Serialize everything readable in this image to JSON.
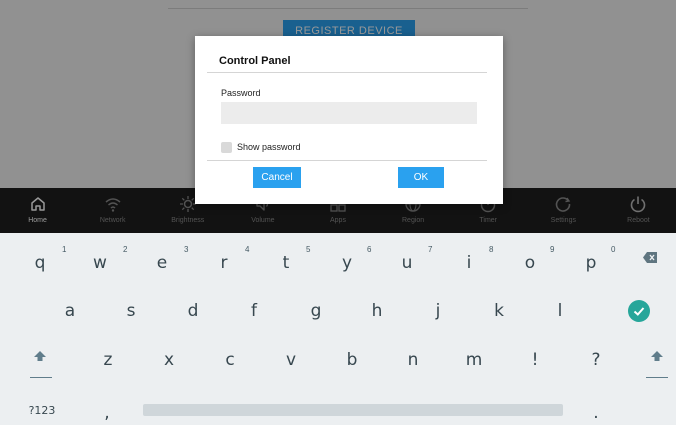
{
  "background": {
    "register_label": "REGISTER DEVICE"
  },
  "navbar": {
    "items": [
      {
        "label": "Home",
        "icon": "home-icon"
      },
      {
        "label": "Network",
        "icon": "wifi-icon"
      },
      {
        "label": "Brightness",
        "icon": "brightness-icon"
      },
      {
        "label": "Volume",
        "icon": "volume-icon"
      },
      {
        "label": "Apps",
        "icon": "apps-icon"
      },
      {
        "label": "Region",
        "icon": "globe-icon"
      },
      {
        "label": "Timer",
        "icon": "timer-icon"
      },
      {
        "label": "Settings",
        "icon": "settings-icon"
      },
      {
        "label": "Reboot",
        "icon": "power-icon"
      }
    ]
  },
  "dialog": {
    "title": "Control Panel",
    "password_label": "Password",
    "password_value": "",
    "show_password_label": "Show password",
    "cancel_label": "Cancel",
    "ok_label": "OK"
  },
  "keyboard": {
    "row1": [
      "q",
      "w",
      "e",
      "r",
      "t",
      "y",
      "u",
      "i",
      "o",
      "p"
    ],
    "row1_hints": [
      "1",
      "2",
      "3",
      "4",
      "5",
      "6",
      "7",
      "8",
      "9",
      "0"
    ],
    "row2": [
      "a",
      "s",
      "d",
      "f",
      "g",
      "h",
      "j",
      "k",
      "l"
    ],
    "row3": [
      "z",
      "x",
      "c",
      "v",
      "b",
      "n",
      "m",
      "!",
      "?"
    ],
    "symbols_label": "?123",
    "comma": ",",
    "period": "."
  },
  "colors": {
    "accent": "#2aa1ef",
    "enter": "#26a69a",
    "navbar": "#1e1e1e"
  }
}
